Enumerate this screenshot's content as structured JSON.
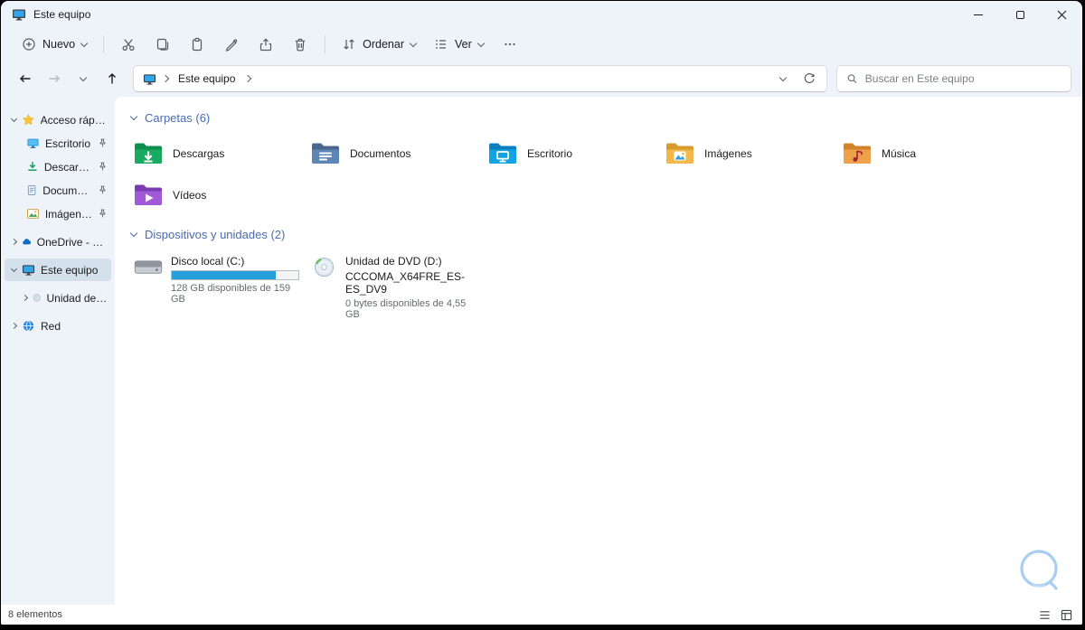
{
  "window": {
    "title": "Este equipo",
    "controls": [
      "minimize",
      "maximize",
      "close"
    ]
  },
  "toolbar": {
    "new_label": "Nuevo",
    "sort_label": "Ordenar",
    "view_label": "Ver",
    "actions": [
      "new",
      "cut",
      "copy",
      "paste",
      "rename",
      "share",
      "delete",
      "sort",
      "view",
      "more"
    ]
  },
  "navbar": {
    "breadcrumb": [
      "Este equipo"
    ],
    "search_placeholder": "Buscar en Este equipo"
  },
  "sidebar": {
    "items": [
      {
        "label": "Acceso rápido",
        "expanded": true
      },
      {
        "label": "Escritorio",
        "pinned": true
      },
      {
        "label": "Descargas",
        "pinned": true
      },
      {
        "label": "Documentos",
        "pinned": true
      },
      {
        "label": "Imágenes",
        "pinned": true
      },
      {
        "label": "OneDrive - Personal"
      },
      {
        "label": "Este equipo",
        "selected": true,
        "expanded": true
      },
      {
        "label": "Unidad de DVD (D:)"
      },
      {
        "label": "Red"
      }
    ]
  },
  "main": {
    "folders_header": "Carpetas (6)",
    "folders": [
      {
        "label": "Descargas"
      },
      {
        "label": "Documentos"
      },
      {
        "label": "Escritorio"
      },
      {
        "label": "Imágenes"
      },
      {
        "label": "Música"
      },
      {
        "label": "Vídeos"
      }
    ],
    "devices_header": "Dispositivos y unidades (2)",
    "drives": [
      {
        "name": "Disco local (C:)",
        "free_text": "128 GB disponibles de 159 GB",
        "used_percent": 82
      },
      {
        "name": "Unidad de DVD (D:)",
        "volume_label": "CCCOMA_X64FRE_ES-ES_DV9",
        "free_text": "0 bytes disponibles de 4,55 GB"
      }
    ]
  },
  "statusbar": {
    "items_count": "8 elementos"
  },
  "colors": {
    "accent": "#0067c0",
    "chrome_bg": "#eef3f9",
    "content_bg": "#ffffff",
    "group_header_text": "#4a6baf",
    "selected_item_bg": "#d5e0ed",
    "drive_bar_fill": "#26a0da",
    "folder_downloads": "#19ab61",
    "folder_documents": "#5e86b5",
    "folder_desktop": "#12a3e3",
    "folder_pictures": "#f0b949",
    "folder_music": "#eda14b",
    "folder_videos": "#a05ad6"
  },
  "icons": {
    "titlebar": [
      "this-pc-icon",
      "minimize-icon",
      "maximize-icon",
      "close-icon"
    ],
    "toolbar": [
      "new-plus-icon",
      "cut-icon",
      "copy-icon",
      "paste-icon",
      "rename-icon",
      "share-icon",
      "delete-icon",
      "sort-icon",
      "view-icon",
      "more-icon",
      "chevron-down-icon"
    ],
    "navbar": [
      "back-icon",
      "forward-icon",
      "recent-locations-icon",
      "up-icon",
      "refresh-icon",
      "search-icon"
    ],
    "sidebar": [
      "star-icon",
      "desktop-icon",
      "downloads-icon",
      "documents-icon",
      "pictures-icon",
      "onedrive-cloud-icon",
      "this-pc-icon",
      "dvd-icon",
      "network-icon",
      "pin-icon"
    ],
    "statusbar": [
      "details-view-icon",
      "thumbnails-view-icon"
    ],
    "other": [
      "watermark-circle-logo",
      "hdd-icon",
      "dvd-disc-icon",
      "folder-icons"
    ]
  }
}
